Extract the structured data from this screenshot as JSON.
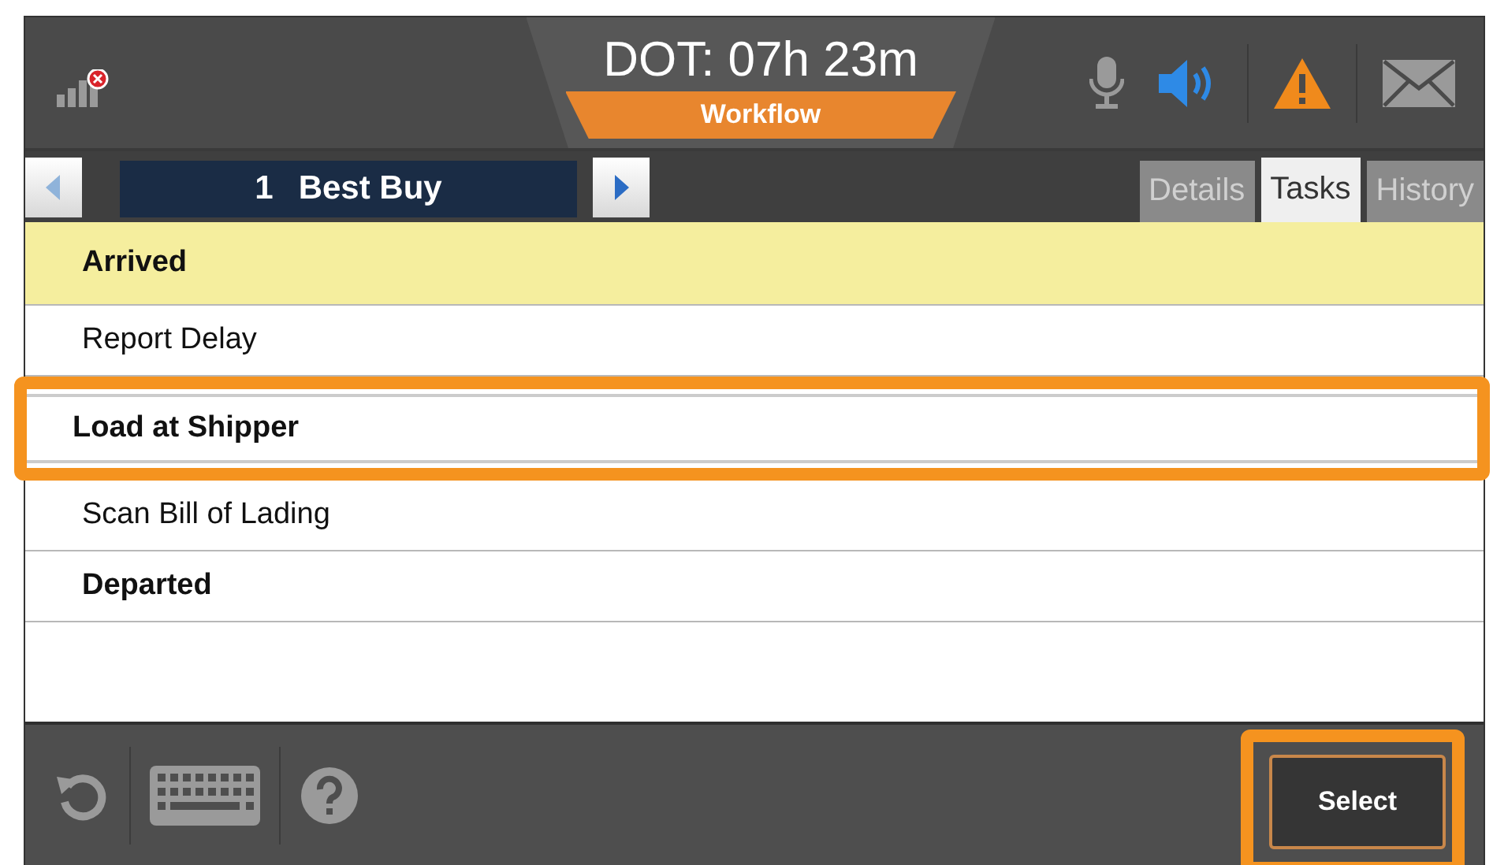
{
  "header": {
    "timer": "DOT: 07h 23m",
    "mode_tab": "Workflow",
    "signal": {
      "error": true
    },
    "microphone": {
      "on": false
    },
    "speaker": {
      "on": true
    },
    "alert": {
      "on": true
    }
  },
  "stop_nav": {
    "number": "1",
    "name": "Best Buy"
  },
  "tabs": [
    {
      "label": "Details",
      "selected": false
    },
    {
      "label": "Tasks",
      "selected": true
    },
    {
      "label": "History",
      "selected": false
    }
  ],
  "tasks": [
    {
      "label": "Arrived",
      "kind": "status",
      "selected": true,
      "highlighted": false
    },
    {
      "label": "Report Delay",
      "kind": "task",
      "selected": false,
      "highlighted": false
    },
    {
      "label": "Load at Shipper",
      "kind": "status",
      "selected": false,
      "highlighted": true
    },
    {
      "label": "Scan Bill of Lading",
      "kind": "task",
      "selected": false,
      "highlighted": false
    },
    {
      "label": "Departed",
      "kind": "status",
      "selected": false,
      "highlighted": false
    }
  ],
  "footer": {
    "select_button": {
      "label": "Select",
      "highlighted": true
    }
  }
}
